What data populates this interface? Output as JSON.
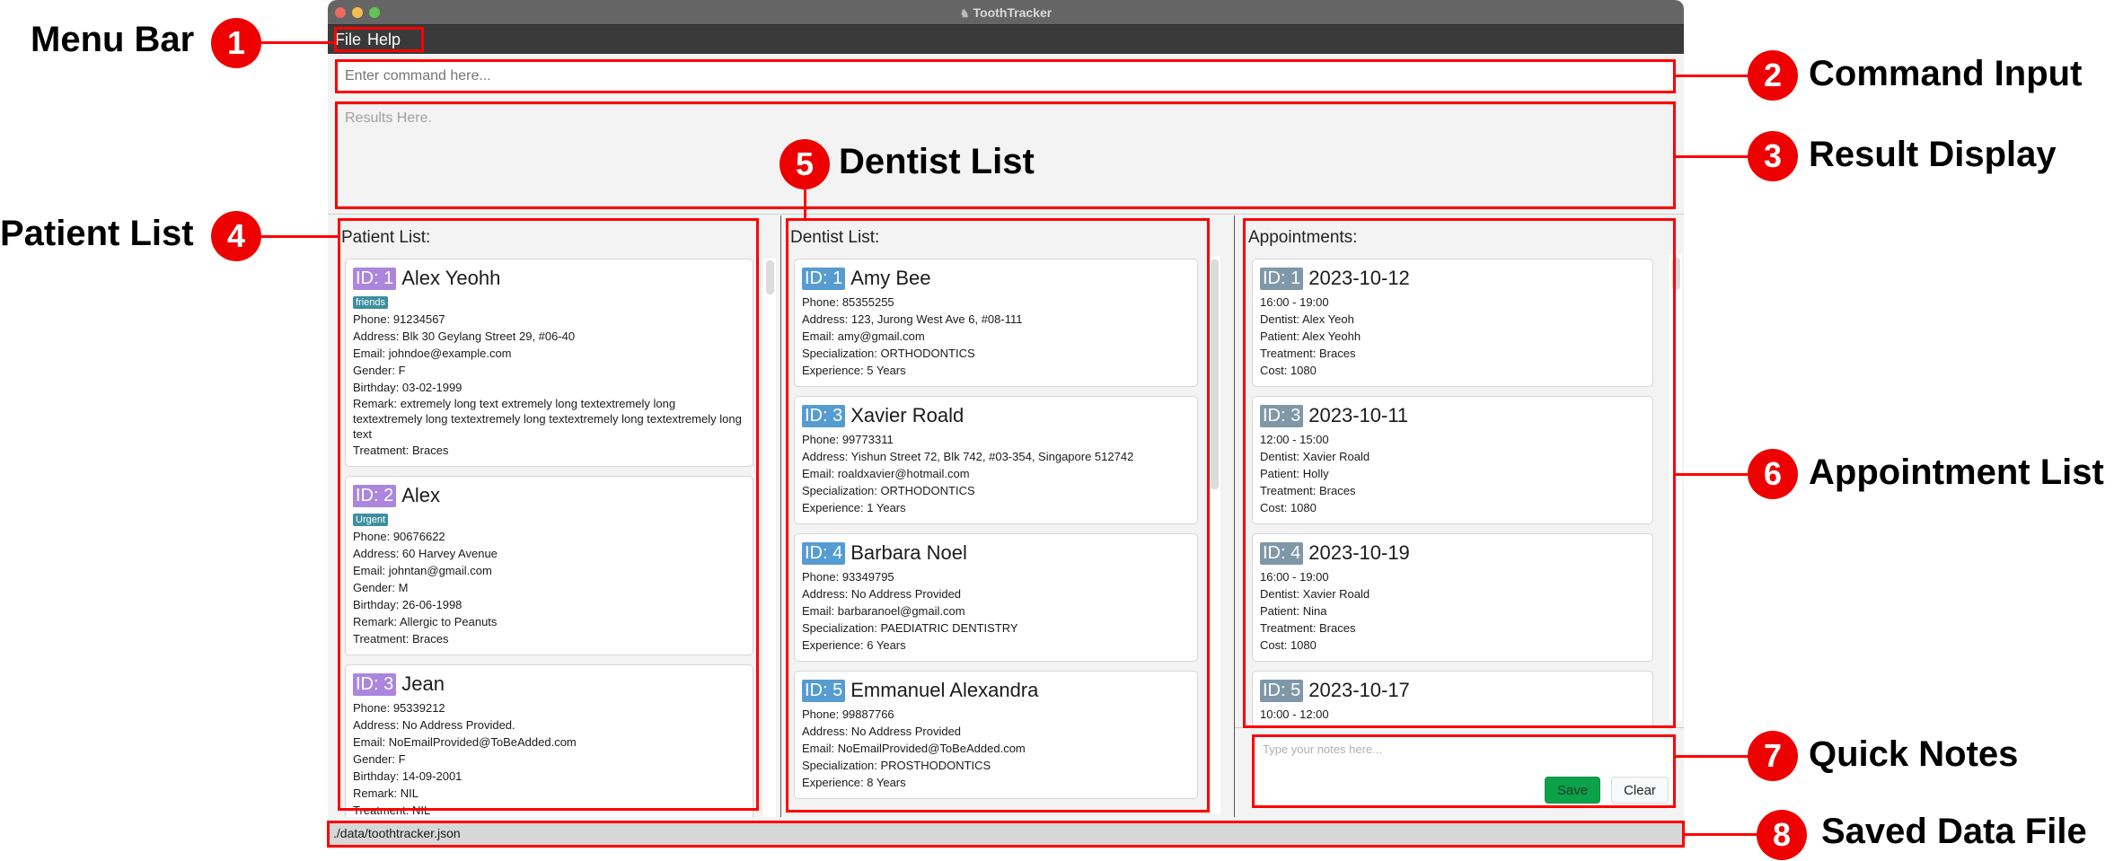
{
  "window": {
    "title": "ToothTracker",
    "title_icon": "tooth-icon"
  },
  "menu": {
    "items": [
      "File",
      "Help"
    ]
  },
  "command_input": {
    "placeholder": "Enter command here...",
    "value": ""
  },
  "result_display": {
    "placeholder": "Results Here."
  },
  "patients": {
    "title": "Patient List:",
    "items": [
      {
        "id": "ID: 1",
        "name": "Alex Yeohh",
        "tag": "friends",
        "phone": "Phone: 91234567",
        "address": "Address: Blk 30 Geylang Street 29, #06-40",
        "email": "Email: johndoe@example.com",
        "gender": "Gender: F",
        "birthday": "Birthday: 03-02-1999",
        "remark": "Remark: extremely long text extremely long textextremely long textextremely long textextremely long textextremely long textextremely long text",
        "treatment": "Treatment: Braces"
      },
      {
        "id": "ID: 2",
        "name": "Alex",
        "tag": "Urgent",
        "phone": "Phone: 90676622",
        "address": "Address: 60 Harvey Avenue",
        "email": "Email: johntan@gmail.com",
        "gender": "Gender: M",
        "birthday": "Birthday: 26-06-1998",
        "remark": "Remark: Allergic to Peanuts",
        "treatment": "Treatment: Braces"
      },
      {
        "id": "ID: 3",
        "name": "Jean",
        "tag": null,
        "phone": "Phone: 95339212",
        "address": "Address: No Address Provided.",
        "email": "Email: NoEmailProvided@ToBeAdded.com",
        "gender": "Gender: F",
        "birthday": "Birthday: 14-09-2001",
        "remark": "Remark: NIL",
        "treatment": "Treatment: NIL"
      }
    ]
  },
  "dentists": {
    "title": "Dentist List:",
    "items": [
      {
        "id": "ID: 1",
        "name": "Amy Bee",
        "phone": "Phone: 85355255",
        "address": "Address: 123, Jurong West Ave 6, #08-111",
        "email": "Email: amy@gmail.com",
        "specialization": "Specialization: ORTHODONTICS",
        "experience": "Experience: 5 Years"
      },
      {
        "id": "ID: 3",
        "name": "Xavier Roald",
        "phone": "Phone: 99773311",
        "address": "Address: Yishun Street 72, Blk 742, #03-354, Singapore 512742",
        "email": "Email: roaldxavier@hotmail.com",
        "specialization": "Specialization: ORTHODONTICS",
        "experience": "Experience: 1 Years"
      },
      {
        "id": "ID: 4",
        "name": "Barbara Noel",
        "phone": "Phone: 93349795",
        "address": "Address: No Address Provided",
        "email": "Email: barbaranoel@gmail.com",
        "specialization": "Specialization: PAEDIATRIC DENTISTRY",
        "experience": "Experience: 6 Years"
      },
      {
        "id": "ID: 5",
        "name": "Emmanuel Alexandra",
        "phone": "Phone: 99887766",
        "address": "Address: No Address Provided",
        "email": "Email: NoEmailProvided@ToBeAdded.com",
        "specialization": "Specialization: PROSTHODONTICS",
        "experience": "Experience: 8 Years"
      }
    ]
  },
  "appointments": {
    "title": "Appointments:",
    "items": [
      {
        "id": "ID: 1",
        "date": "2023-10-12",
        "time": "16:00 - 19:00",
        "dentist": "Dentist: Alex Yeoh",
        "patient": "Patient: Alex Yeohh",
        "treatment": "Treatment: Braces",
        "cost": "Cost: 1080"
      },
      {
        "id": "ID: 3",
        "date": "2023-10-11",
        "time": "12:00 - 15:00",
        "dentist": "Dentist: Xavier Roald",
        "patient": "Patient: Holly",
        "treatment": "Treatment: Braces",
        "cost": "Cost: 1080"
      },
      {
        "id": "ID: 4",
        "date": "2023-10-19",
        "time": "16:00 - 19:00",
        "dentist": "Dentist: Xavier Roald",
        "patient": "Patient: Nina",
        "treatment": "Treatment: Braces",
        "cost": "Cost: 1080"
      },
      {
        "id": "ID: 5",
        "date": "2023-10-17",
        "time": "10:00 - 12:00"
      }
    ]
  },
  "quick_notes": {
    "placeholder": "Type your notes here...",
    "save_label": "Save",
    "clear_label": "Clear"
  },
  "status_bar": {
    "file_path": "./data/toothtracker.json"
  },
  "annotations": [
    {
      "number": "1",
      "label": "Menu Bar"
    },
    {
      "number": "2",
      "label": "Command Input"
    },
    {
      "number": "3",
      "label": "Result Display"
    },
    {
      "number": "4",
      "label": "Patient List"
    },
    {
      "number": "5",
      "label": "Dentist List"
    },
    {
      "number": "6",
      "label": "Appointment List"
    },
    {
      "number": "7",
      "label": "Quick Notes"
    },
    {
      "number": "8",
      "label": "Saved Data File"
    }
  ],
  "colors": {
    "annotation": "#ff0000",
    "patient_id_badge": "#a77fdd",
    "dentist_id_badge": "#4e97cf",
    "appointment_id_badge": "#7893a4",
    "tag": "#3d8fa0",
    "save_button": "#0ba24a"
  }
}
